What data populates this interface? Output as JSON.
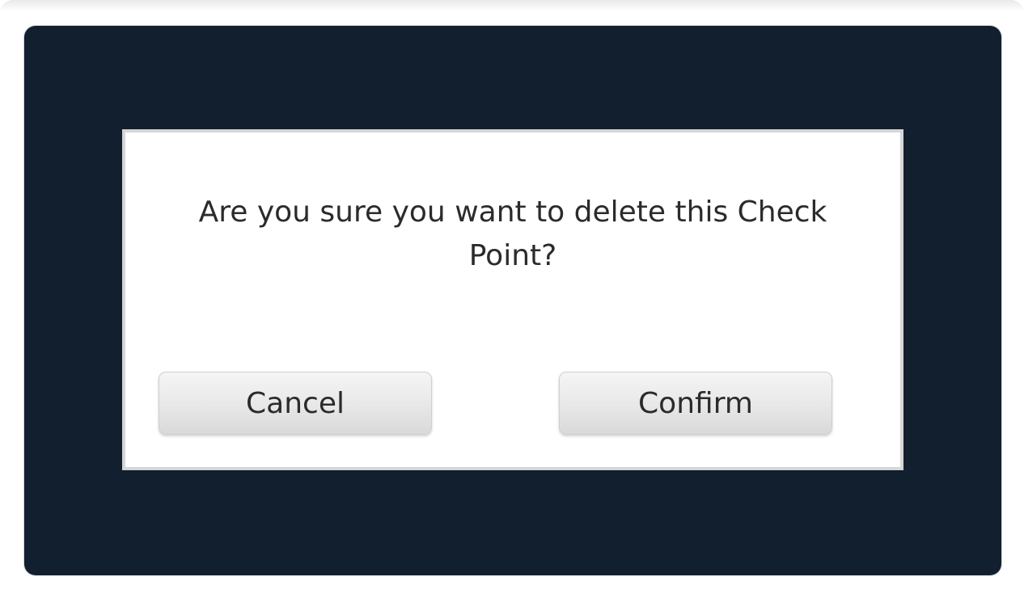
{
  "dialog": {
    "message": "Are you sure you want to delete this Check Point?",
    "cancel_label": "Cancel",
    "confirm_label": "Confirm"
  },
  "colors": {
    "screen_background": "#111f2f",
    "dialog_background": "#ffffff",
    "dialog_border": "#d6d6d6",
    "button_face": "#e6e6e6",
    "text": "#2b2b2b"
  }
}
